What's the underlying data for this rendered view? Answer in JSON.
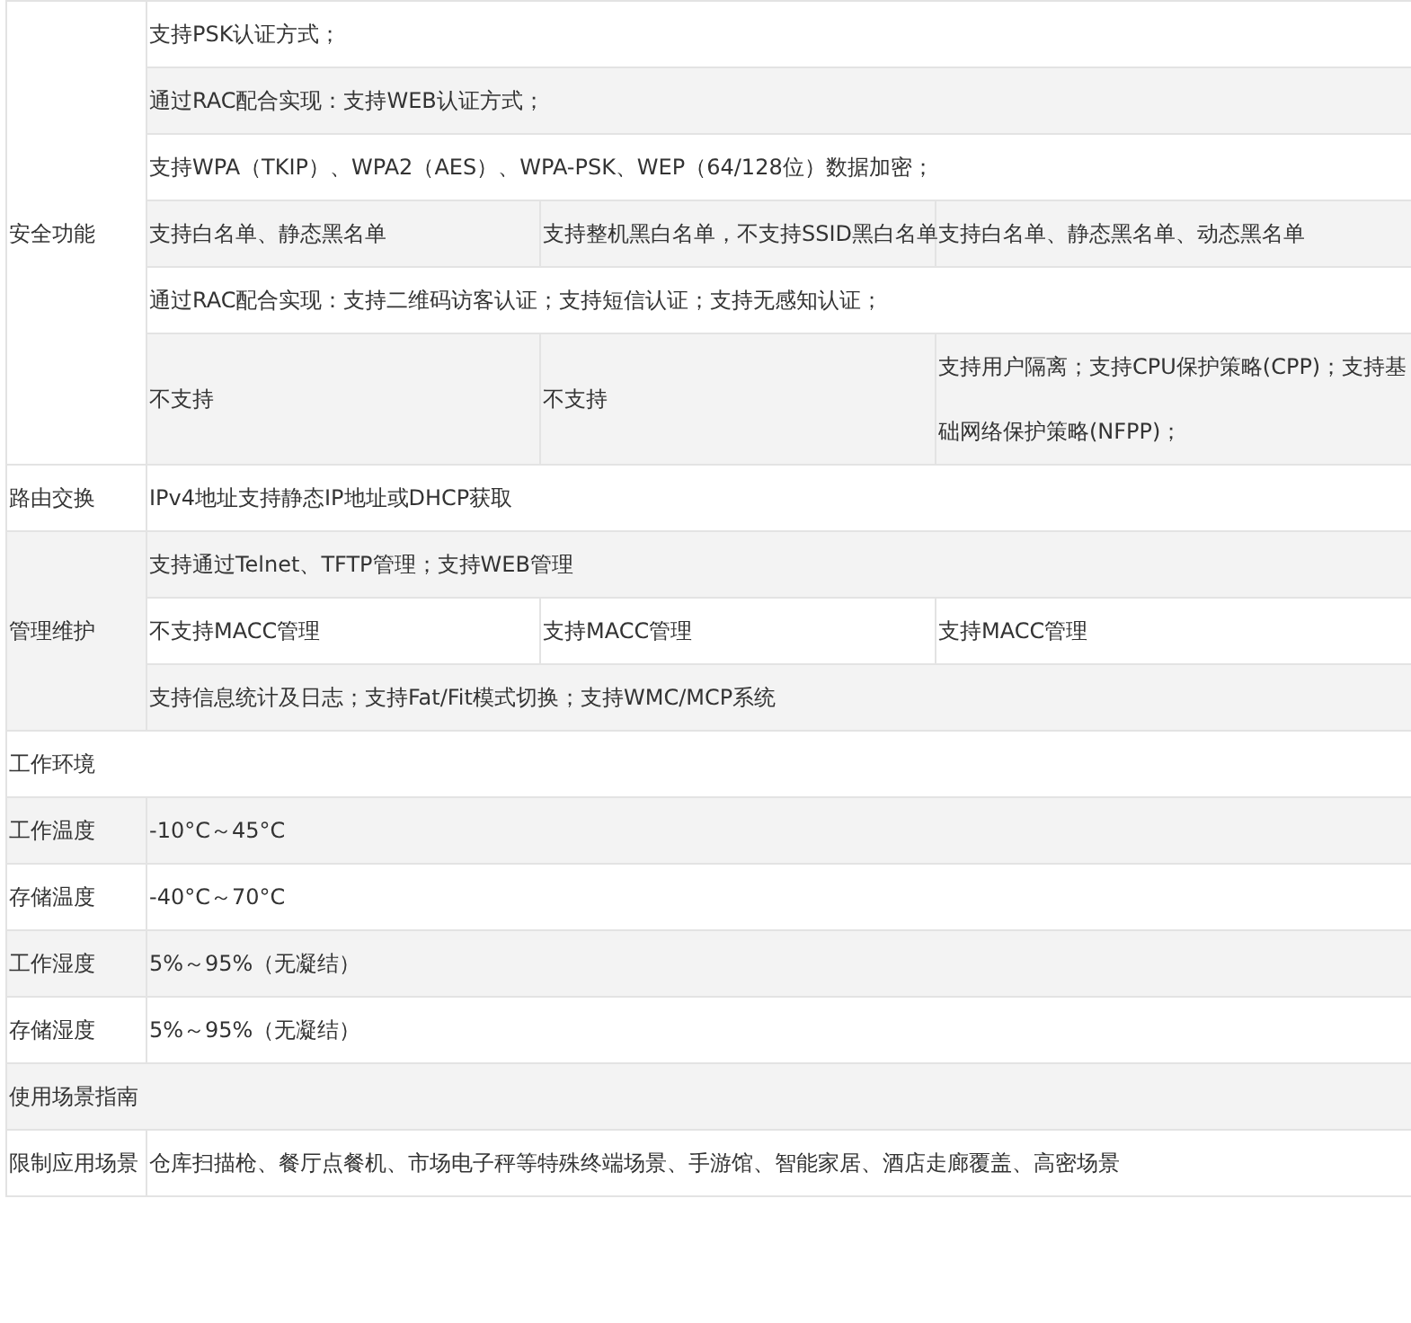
{
  "spec_table": {
    "rows": [
      {
        "kind": "group",
        "label": "安全功能",
        "rows": [
          [
            {
              "text": "支持PSK认证方式；",
              "colspan": 3
            }
          ],
          [
            {
              "text": "通过RAC配合实现：支持WEB认证方式；",
              "colspan": 3
            }
          ],
          [
            {
              "text": "支持WPA（TKIP）、WPA2（AES）、WPA-PSK、WEP（64/128位）数据加密；",
              "colspan": 3
            }
          ],
          [
            {
              "text": "支持白名单、静态黑名单"
            },
            {
              "text": "支持整机黑白名单，不支持SSID黑白名单"
            },
            {
              "text": "支持白名单、静态黑名单、动态黑名单"
            }
          ],
          [
            {
              "text": "通过RAC配合实现：支持二维码访客认证；支持短信认证；支持无感知认证；",
              "colspan": 3
            }
          ],
          [
            {
              "text": "不支持"
            },
            {
              "text": "不支持"
            },
            {
              "text": "支持用户隔离；支持CPU保护策略(CPP)；支持基础网络保护策略(NFPP)；"
            }
          ]
        ]
      },
      {
        "kind": "group",
        "label": "路由交换",
        "rows": [
          [
            {
              "text": "IPv4地址支持静态IP地址或DHCP获取",
              "colspan": 3
            }
          ]
        ]
      },
      {
        "kind": "group",
        "label": "管理维护",
        "rows": [
          [
            {
              "text": "支持通过Telnet、TFTP管理；支持WEB管理",
              "colspan": 3
            }
          ],
          [
            {
              "text": "不支持MACC管理"
            },
            {
              "text": "支持MACC管理"
            },
            {
              "text": "支持MACC管理"
            }
          ],
          [
            {
              "text": "支持信息统计及日志；支持Fat/Fit模式切换；支持WMC/MCP系统",
              "colspan": 3
            }
          ]
        ]
      },
      {
        "kind": "heading",
        "label": "工作环境",
        "colspan": 4
      },
      {
        "kind": "group",
        "label": "工作温度",
        "rows": [
          [
            {
              "text": "-10°C～45°C",
              "colspan": 3
            }
          ]
        ]
      },
      {
        "kind": "group",
        "label": "存储温度",
        "rows": [
          [
            {
              "text": "-40°C～70°C",
              "colspan": 3
            }
          ]
        ]
      },
      {
        "kind": "group",
        "label": "工作湿度",
        "rows": [
          [
            {
              "text": "5%～95%（无凝结）",
              "colspan": 3
            }
          ]
        ]
      },
      {
        "kind": "group",
        "label": "存储湿度",
        "rows": [
          [
            {
              "text": "5%～95%（无凝结）",
              "colspan": 3
            }
          ]
        ]
      },
      {
        "kind": "heading",
        "label": "使用场景指南",
        "colspan": 4
      },
      {
        "kind": "group",
        "label": "限制应用场景",
        "rows": [
          [
            {
              "text": "仓库扫描枪、餐厅点餐机、市场电子秤等特殊终端场景、手游馆、智能家居、酒店走廊覆盖、高密场景",
              "colspan": 3
            }
          ]
        ]
      }
    ]
  }
}
